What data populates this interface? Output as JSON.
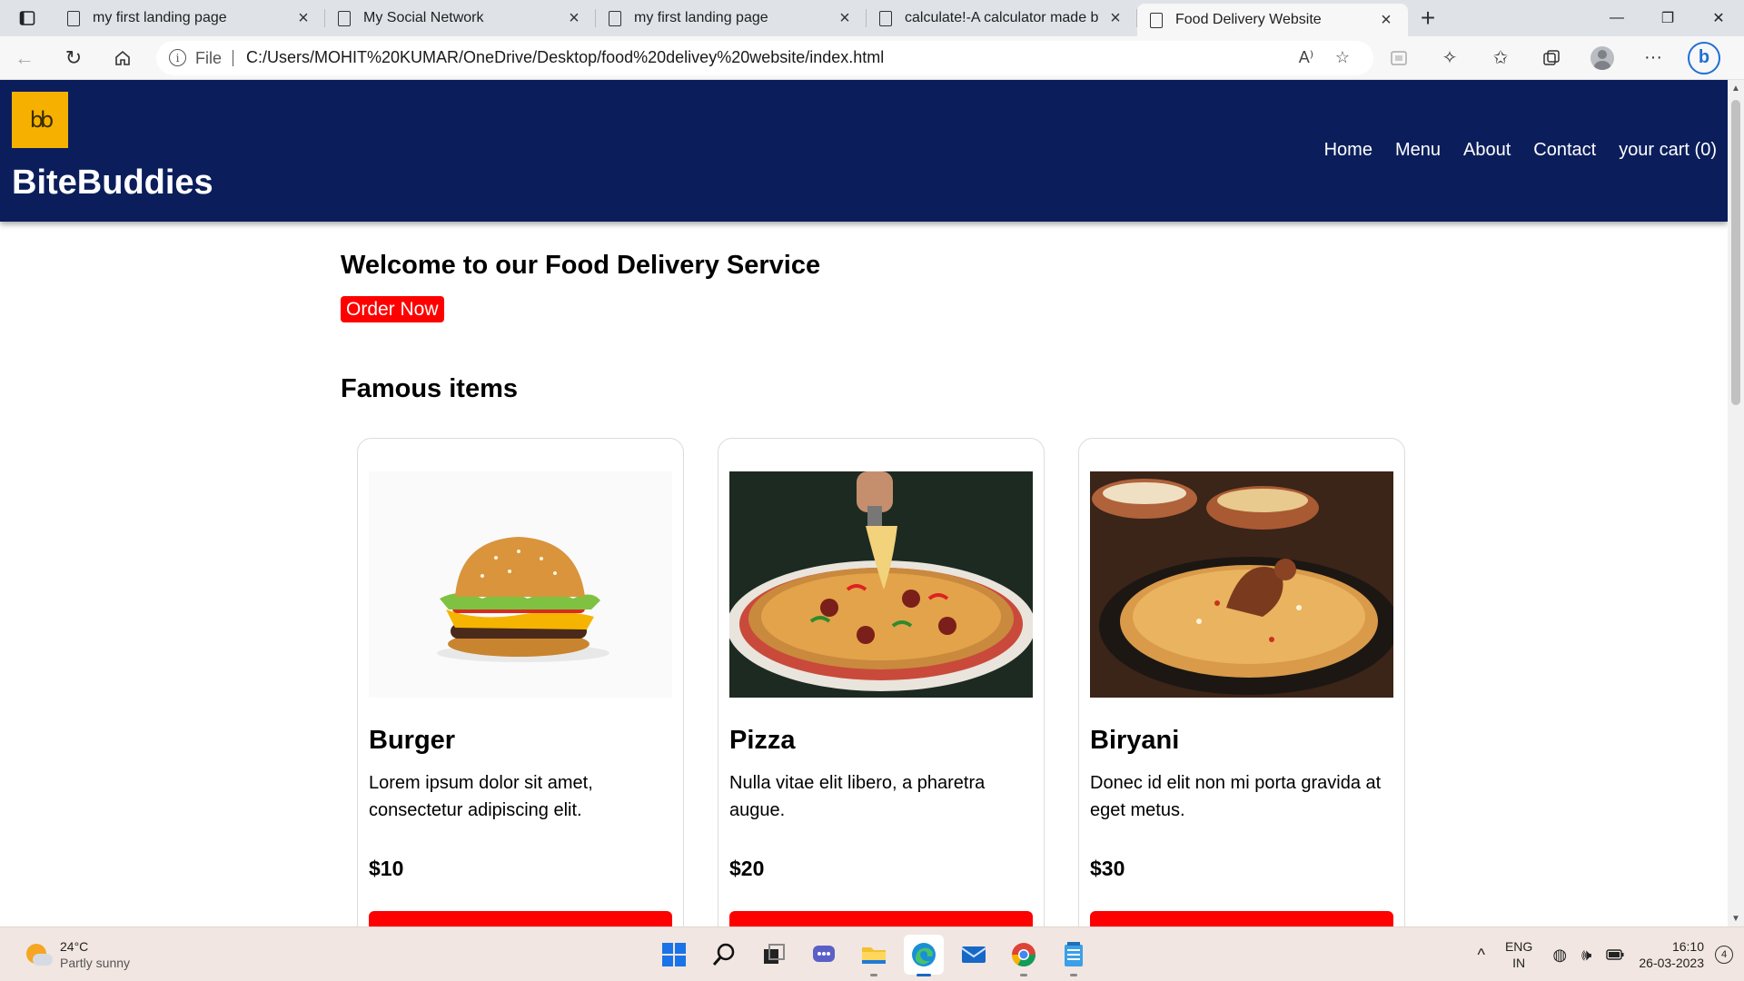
{
  "browser": {
    "tabs": [
      {
        "title": "my first landing page",
        "active": false
      },
      {
        "title": "My Social Network",
        "active": false
      },
      {
        "title": "my first landing page",
        "active": false
      },
      {
        "title": "calculate!-A calculator made by m",
        "active": false
      },
      {
        "title": "Food Delivery Website",
        "active": true
      }
    ],
    "file_label": "File",
    "url": "C:/Users/MOHIT%20KUMAR/OneDrive/Desktop/food%20delivey%20website/index.html"
  },
  "site": {
    "logo_glyph": "bb",
    "brand": "BiteBuddies",
    "nav": [
      "Home",
      "Menu",
      "About",
      "Contact",
      "your cart (0)"
    ],
    "welcome_heading": "Welcome to our Food Delivery Service",
    "order_button": "Order Now",
    "famous_heading": "Famous items",
    "items": [
      {
        "name": "Burger",
        "description": "Lorem ipsum dolor sit amet, consectetur adipiscing elit.",
        "price": "$10"
      },
      {
        "name": "Pizza",
        "description": "Nulla vitae elit libero, a pharetra augue.",
        "price": "$20"
      },
      {
        "name": "Biryani",
        "description": "Donec id elit non mi porta gravida at eget metus.",
        "price": "$30"
      }
    ]
  },
  "taskbar": {
    "weather_temp": "24°C",
    "weather_condition": "Partly sunny",
    "lang_line1": "ENG",
    "lang_line2": "IN",
    "time": "16:10",
    "date": "26-03-2023",
    "notification_count": "4"
  },
  "colors": {
    "header_bg": "#0b1e5b",
    "logo_bg": "#f6b100",
    "accent_red": "#ff0000"
  }
}
